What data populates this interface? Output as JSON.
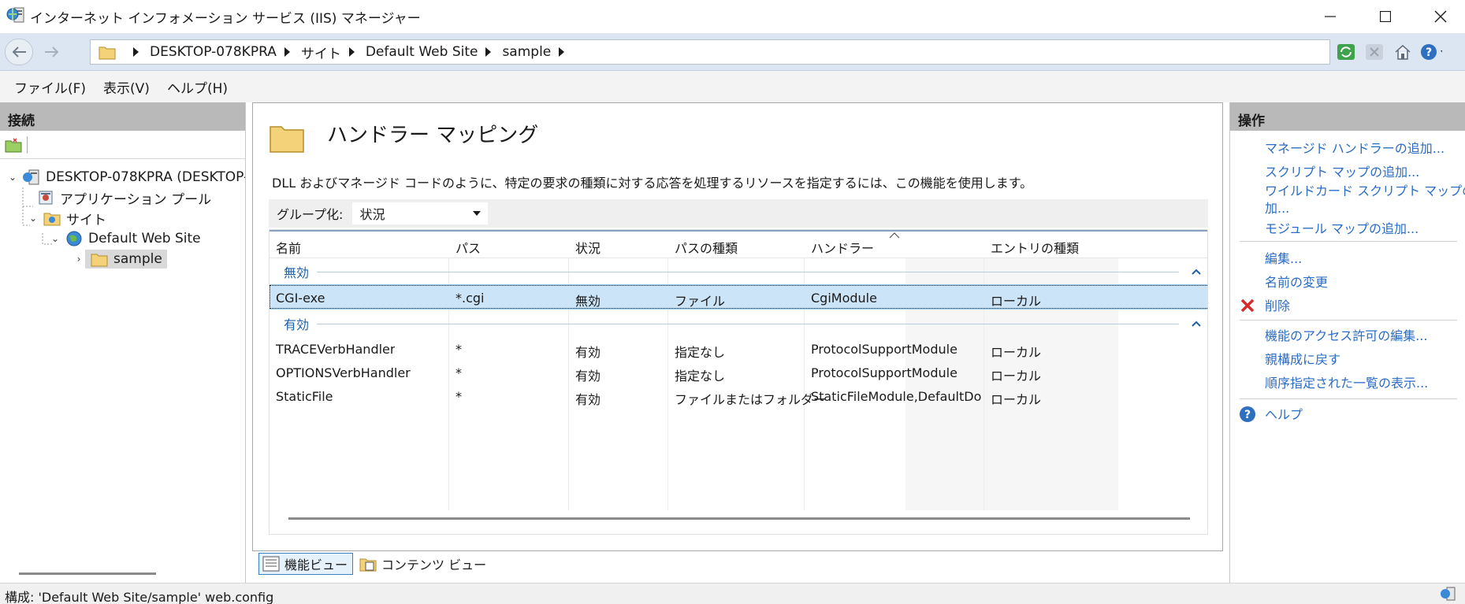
{
  "window": {
    "title": "インターネット インフォメーション サービス (IIS) マネージャー"
  },
  "breadcrumb": [
    "DESKTOP-078KPRA",
    "サイト",
    "Default Web Site",
    "sample"
  ],
  "menu": [
    "ファイル(F)",
    "表示(V)",
    "ヘルプ(H)"
  ],
  "connections": {
    "header": "接続",
    "tree": [
      {
        "label": "DESKTOP-078KPRA (DESKTOP-",
        "level": 0,
        "expanded": true,
        "icon": "server-icon"
      },
      {
        "label": "アプリケーション プール",
        "level": 1,
        "icon": "app-pool-icon"
      },
      {
        "label": "サイト",
        "level": 1,
        "expanded": true,
        "icon": "sites-folder-icon"
      },
      {
        "label": "Default Web Site",
        "level": 2,
        "expanded": true,
        "icon": "globe-icon"
      },
      {
        "label": "sample",
        "level": 3,
        "expanded": false,
        "selected": true,
        "icon": "folder-icon"
      }
    ]
  },
  "feature": {
    "title": "ハンドラー マッピング",
    "description": "DLL およびマネージド コードのように、特定の要求の種類に対する応答を処理するリソースを指定するには、この機能を使用します。",
    "group_by_label": "グループ化:",
    "group_by_value": "状況"
  },
  "grid": {
    "columns": [
      "名前",
      "パス",
      "状況",
      "パスの種類",
      "ハンドラー",
      "エントリの種類"
    ],
    "sorted_column": "ハンドラー",
    "groups": [
      {
        "title": "無効",
        "rows": [
          {
            "name": "CGI-exe",
            "path": "*.cgi",
            "state": "無効",
            "path_type": "ファイル",
            "handler": "CgiModule",
            "entry_type": "ローカル",
            "selected": true
          }
        ]
      },
      {
        "title": "有効",
        "rows": [
          {
            "name": "TRACEVerbHandler",
            "path": "*",
            "state": "有効",
            "path_type": "指定なし",
            "handler": "ProtocolSupportModule",
            "entry_type": "ローカル"
          },
          {
            "name": "OPTIONSVerbHandler",
            "path": "*",
            "state": "有効",
            "path_type": "指定なし",
            "handler": "ProtocolSupportModule",
            "entry_type": "ローカル"
          },
          {
            "name": "StaticFile",
            "path": "*",
            "state": "有効",
            "path_type": "ファイルまたはフォルダー",
            "handler": "StaticFileModule,DefaultDocu...",
            "entry_type": "ローカル"
          }
        ]
      }
    ]
  },
  "view_tabs": {
    "feature": "機能ビュー",
    "content": "コンテンツ ビュー"
  },
  "actions": {
    "header": "操作",
    "add_managed": "マネージド ハンドラーの追加...",
    "add_script": "スクリプト マップの追加...",
    "add_wildcard_1": "ワイルドカード スクリプト マップの追",
    "add_wildcard_2": "加...",
    "add_module": "モジュール マップの追加...",
    "edit": "編集...",
    "rename": "名前の変更",
    "delete": "削除",
    "edit_permissions": "機能のアクセス許可の編集...",
    "revert": "親構成に戻す",
    "ordered_list": "順序指定された一覧の表示...",
    "help": "ヘルプ"
  },
  "status": {
    "text": "構成: 'Default Web Site/sample' web.config"
  },
  "colors": {
    "accent_link": "#2b6cc4",
    "selection": "#cce4f7",
    "pane_header": "#b9b9b9",
    "group_title": "#1f5fa8"
  }
}
